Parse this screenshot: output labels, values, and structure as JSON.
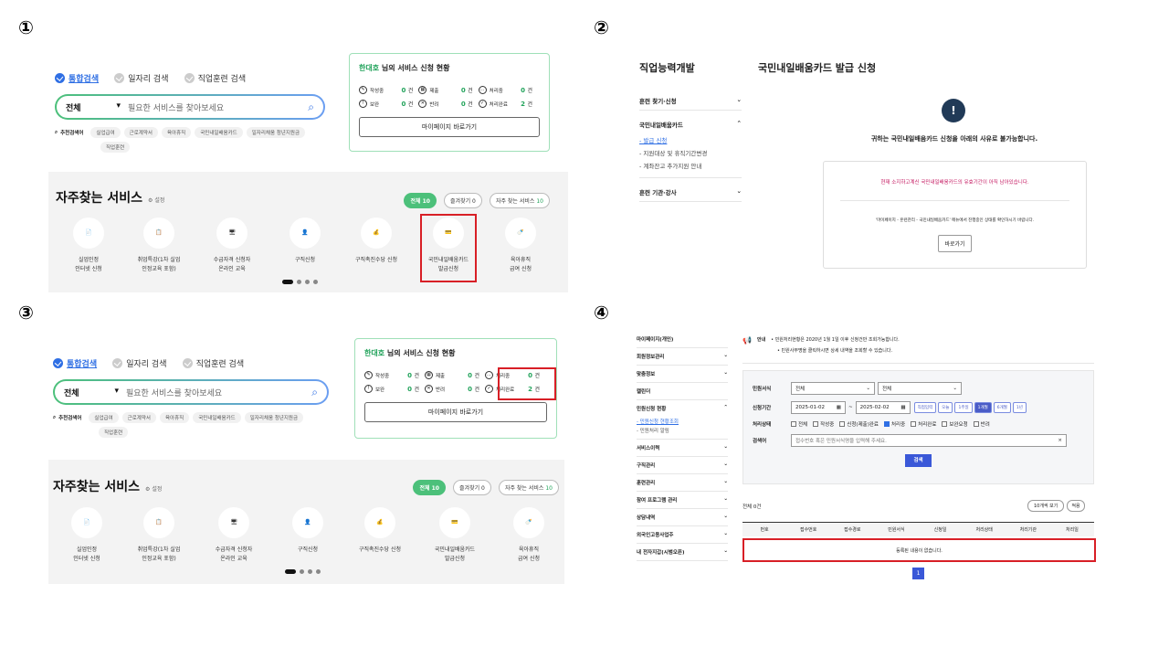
{
  "labels": {
    "p1": "①",
    "p2": "②",
    "p3": "③",
    "p4": "④"
  },
  "search": {
    "radios": [
      {
        "label": "통합검색",
        "on": true
      },
      {
        "label": "일자리 검색",
        "on": false
      },
      {
        "label": "직업훈련 검색",
        "on": false
      }
    ],
    "select": "전체",
    "placeholder": "필요한 서비스를 찾아보세요",
    "kw_label": "추천검색어",
    "chips": [
      "실업급여",
      "근로계약서",
      "육아휴직",
      "국민내일배움카드",
      "일자리채움 청년지원금",
      "직업훈련"
    ]
  },
  "status": {
    "name": "한대호",
    "suffix": " 님의 서비스 신청 현황",
    "row1": [
      {
        "icon": "✎",
        "label": "작성중",
        "count": "0",
        "unit": "건"
      },
      {
        "icon": "▦",
        "label": "제출",
        "count": "0",
        "unit": "건"
      },
      {
        "icon": "…",
        "label": "처리중",
        "count": "0",
        "unit": "건"
      }
    ],
    "row2": [
      {
        "icon": "!",
        "label": "보완",
        "count": "0",
        "unit": "건"
      },
      {
        "icon": "✕",
        "label": "반려",
        "count": "0",
        "unit": "건"
      },
      {
        "icon": "✓",
        "label": "처리완료",
        "count": "2",
        "unit": "건"
      }
    ],
    "mypage_btn": "마이페이지 바로가기"
  },
  "fav": {
    "title": "자주찾는 서비스",
    "setting": "⚙ 설정",
    "pills": [
      {
        "text": "전체",
        "n": "10"
      },
      {
        "text": "즐겨찾기",
        "n": "0"
      },
      {
        "text": "자주 찾는 서비스",
        "n": "10"
      }
    ],
    "items": [
      {
        "icon": "📄",
        "l1": "실업인정",
        "l2": "인터넷 신청"
      },
      {
        "icon": "📋",
        "l1": "취업특강(1차 실업",
        "l2": "인정교육 포함)"
      },
      {
        "icon": "🖥",
        "l1": "수급자격 신청자",
        "l2": "온라인 교육"
      },
      {
        "icon": "👤",
        "l1": "구직신청",
        "l2": ""
      },
      {
        "icon": "💰",
        "l1": "구직촉진수당 신청",
        "l2": ""
      },
      {
        "icon": "💳",
        "l1": "국민내일배움카드",
        "l2": "발급신청"
      },
      {
        "icon": "🍼",
        "l1": "육아휴직",
        "l2": "급여 신청"
      }
    ]
  },
  "p2": {
    "side_title": "직업능력개발",
    "side_items": [
      {
        "label": "훈련 찾기·신청",
        "arrow": "⌄"
      },
      {
        "label": "국민내일배움카드",
        "arrow": "⌃"
      }
    ],
    "side_subs": [
      "- 발급 신청",
      "- 지원대상 및 휴직기간변경",
      "- 계좌잔고 추가지원 안내"
    ],
    "side_last": {
      "label": "훈련 기관·강사",
      "arrow": "⌄"
    },
    "title": "국민내일배움카드 발급 신청",
    "alert_icon": "!",
    "msg": "귀하는 국민내일배움카드 신청을 아래의 사유로 불가능합니다.",
    "reason": "현재 소지하고계신 국민내일배움카드의 유효기간이 아직 남아있습니다.",
    "note": "'마이페이지 - 훈련관리 - 국민내일배움카드' 메뉴에서 진행중인 상태를 확인하시기 바랍니다.",
    "btn": "바로가기"
  },
  "p4": {
    "nav": [
      {
        "label": "마이페이지(개인)",
        "arrow": ""
      },
      {
        "label": "회원정보관리",
        "arrow": "⌄"
      },
      {
        "label": "맞춤정보",
        "arrow": "⌄"
      },
      {
        "label": "캘린더",
        "arrow": ""
      },
      {
        "label": "민원신청 현황",
        "arrow": "⌃"
      }
    ],
    "nav_subs": [
      "- 민원신청 현황조회",
      "- 민원처리 알림"
    ],
    "nav2": [
      {
        "label": "서비스이력",
        "arrow": "⌄"
      },
      {
        "label": "구직관리",
        "arrow": "⌄"
      },
      {
        "label": "훈련관리",
        "arrow": "⌄"
      },
      {
        "label": "참여 프로그램 관리",
        "arrow": "⌄"
      },
      {
        "label": "상담내역",
        "arrow": "⌄"
      },
      {
        "label": "외국인고용사업주",
        "arrow": "⌄"
      },
      {
        "label": "내 전자지갑(시범오픈)",
        "arrow": "⌄"
      }
    ],
    "notice_label": "안내",
    "notice1": "• 민원처리현황은 2020년 1월 1일 이후 신청건만 조회가능합니다.",
    "notice2": "• 민원사무명을 클릭하시면 상세 내역을 조회할 수 있습니다.",
    "f_type": "민원서식",
    "f_type_v1": "전체",
    "f_type_v2": "전체",
    "f_period": "신청기간",
    "f_from": "2025-01-02",
    "f_to": "2025-02-02",
    "f_tilde": "~",
    "quick": [
      {
        "t": "직접입력",
        "on": false
      },
      {
        "t": "오늘",
        "on": false
      },
      {
        "t": "1주일",
        "on": false
      },
      {
        "t": "1개월",
        "on": true
      },
      {
        "t": "6개월",
        "on": false
      },
      {
        "t": "1년",
        "on": false
      }
    ],
    "f_state": "처리상태",
    "states": [
      {
        "t": "전체",
        "on": false
      },
      {
        "t": "작성중",
        "on": false
      },
      {
        "t": "신청(제출)완료",
        "on": false
      },
      {
        "t": "처리중",
        "on": true
      },
      {
        "t": "처리완료",
        "on": false
      },
      {
        "t": "보완요청",
        "on": false
      },
      {
        "t": "반려",
        "on": false
      }
    ],
    "f_search": "검색어",
    "f_search_ph": "접수번호 혹은 민원서식명을 입력해 주세요.",
    "search_btn": "검색",
    "total": "전체 0건",
    "per_page": "10개씩 보기",
    "sort": "적용",
    "cols": [
      "번호",
      "접수번호",
      "접수경로",
      "민원서식",
      "신청일",
      "처리상태",
      "처리기관",
      "처리일"
    ],
    "empty": "등록된 내용이 없습니다.",
    "page": "1"
  }
}
